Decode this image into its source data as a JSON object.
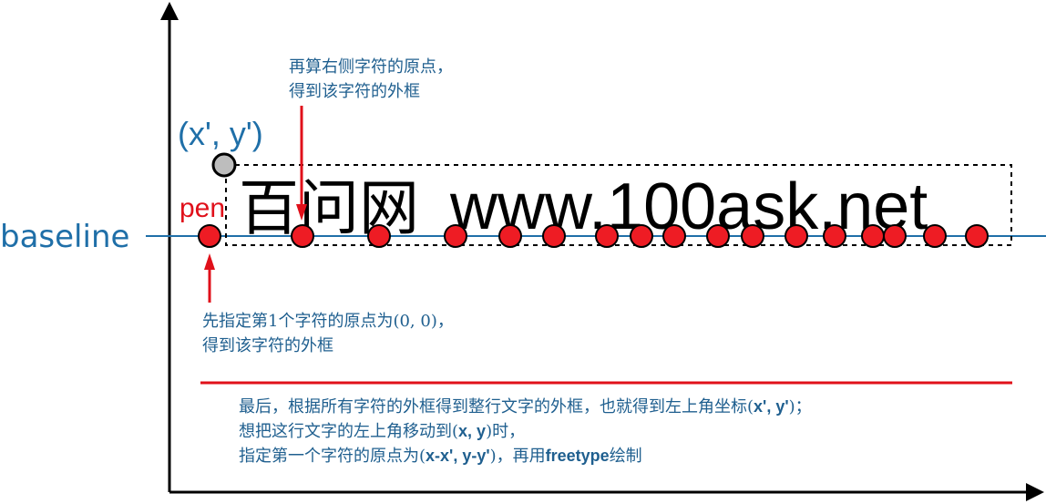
{
  "axis_label_baseline": "baseline",
  "pen_label": "pen",
  "coord_label": "(x', y')",
  "main_text_cn": "百问网",
  "main_text_en": "www.100ask.net",
  "note_top": {
    "line1": "再算右侧字符的原点，",
    "line2": "得到该字符的外框"
  },
  "note_left": {
    "line1": "先指定第1个字符的原点为(0, 0)，",
    "line2": "得到该字符的外框"
  },
  "note_bottom": {
    "line1_a": "最后，根据所有字符的外框得到整行文字的外框，也就得到左上角坐标(",
    "line1_b": "x', y'",
    "line1_c": ")；",
    "line2_a": "想把这行文字的左上角移动到(",
    "line2_b": "x, y",
    "line2_c": ")时，",
    "line3_a": "指定第一个字符的原点为(",
    "line3_b": "x-x', y-y'",
    "line3_c": ")，再用",
    "line3_d": "freetype",
    "line3_e": "绘制"
  },
  "colors": {
    "blue": "#1f6fa8",
    "note_blue": "#1f5f8f",
    "red": "#e0101a",
    "dot_red": "#ee1c24",
    "grey": "#bdbdbd"
  }
}
